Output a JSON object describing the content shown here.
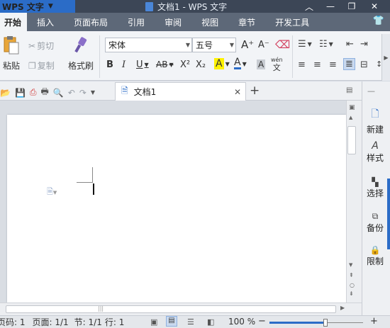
{
  "app": {
    "menu_label": "WPS 文字",
    "window_title": "文档1 - WPS 文字"
  },
  "window_controls": {
    "collapse": "︿",
    "minimize": "—",
    "maximize": "❐",
    "close": "✕"
  },
  "tabs": [
    "开始",
    "插入",
    "页面布局",
    "引用",
    "审阅",
    "视图",
    "章节",
    "开发工具"
  ],
  "ribbon": {
    "paste": "粘贴",
    "cut": "剪切",
    "copy": "复制",
    "format_painter": "格式刷",
    "font_name": "宋体",
    "font_size": "五号",
    "grow_font": "A⁺",
    "shrink_font": "A⁻",
    "bold": "B",
    "italic": "I",
    "underline": "U",
    "strikethrough": "AB",
    "superscript": "X²",
    "subscript": "X₂",
    "highlight": "A",
    "font_color": "A",
    "char_shading": "A",
    "phonetic": "wén"
  },
  "doc_tab": {
    "title": "文档1",
    "close": "✕",
    "new": "+"
  },
  "right_panel": [
    "新建",
    "样式",
    "选择",
    "备份",
    "限制"
  ],
  "status": {
    "page_section": "页码: 1",
    "page": "页面: 1/1",
    "section": "节: 1/1",
    "line": "行: 1",
    "zoom": "100 %",
    "zoom_level": 0.6
  },
  "colors": {
    "accent": "#2b6cc7",
    "titlebar": "#3c4656",
    "tabbar": "#5d6878"
  }
}
